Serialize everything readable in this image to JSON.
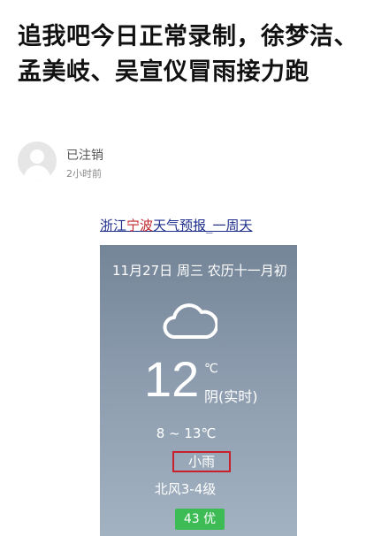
{
  "article": {
    "headline": "追我吧今日正常录制，徐梦洁、孟美岐、吴宣仪冒雨接力跑"
  },
  "author": {
    "name": "已注销",
    "time": "2小时前"
  },
  "image": {
    "source_line_a": "浙江",
    "source_line_b": "宁波",
    "source_line_c": "天气预报_一周天",
    "weather": {
      "date_line": "11月27日 周三 农历十一月初",
      "temperature": "12",
      "unit": "℃",
      "condition": "阴(实时)",
      "range": "8 ~ 13℃",
      "forecast": "小雨",
      "wind": "北风3-4级",
      "aqi": "43 优",
      "icon": "cloud-icon"
    }
  }
}
